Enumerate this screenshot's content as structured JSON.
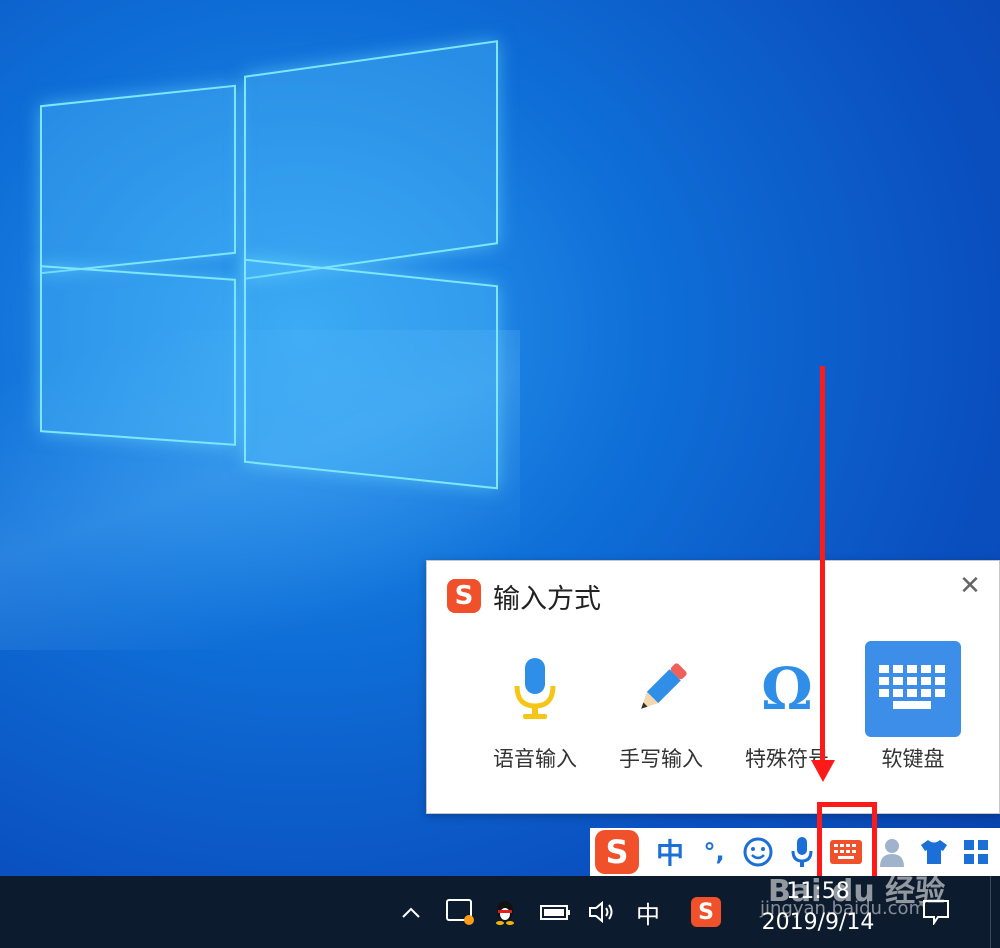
{
  "popup": {
    "title": "输入方式",
    "close_glyph": "✕",
    "logo_glyph": "S",
    "options": [
      {
        "label": "语音输入",
        "icon": "microphone-icon"
      },
      {
        "label": "手写输入",
        "icon": "pencil-icon"
      },
      {
        "label": "特殊符号",
        "icon": "omega-icon"
      },
      {
        "label": "软键盘",
        "icon": "keyboard-icon",
        "selected": true
      }
    ]
  },
  "status_bar": {
    "logo_glyph": "S",
    "lang": "中",
    "punct": "°,",
    "items": [
      "emoji-icon",
      "microphone-icon",
      "keyboard-icon",
      "user-icon",
      "shirt-icon",
      "grid-icon"
    ]
  },
  "taskbar": {
    "chevron": "^",
    "ime_lang": "中",
    "time": "11:58",
    "date": "2019/9/14"
  },
  "watermark": {
    "brand": "Bai du 经验",
    "url": "jingyan.baidu.com"
  },
  "colors": {
    "accent": "#3d8ee8",
    "sogou": "#f0502a",
    "highlight": "#ff1a1a",
    "taskbar": "#0d1b2e"
  }
}
